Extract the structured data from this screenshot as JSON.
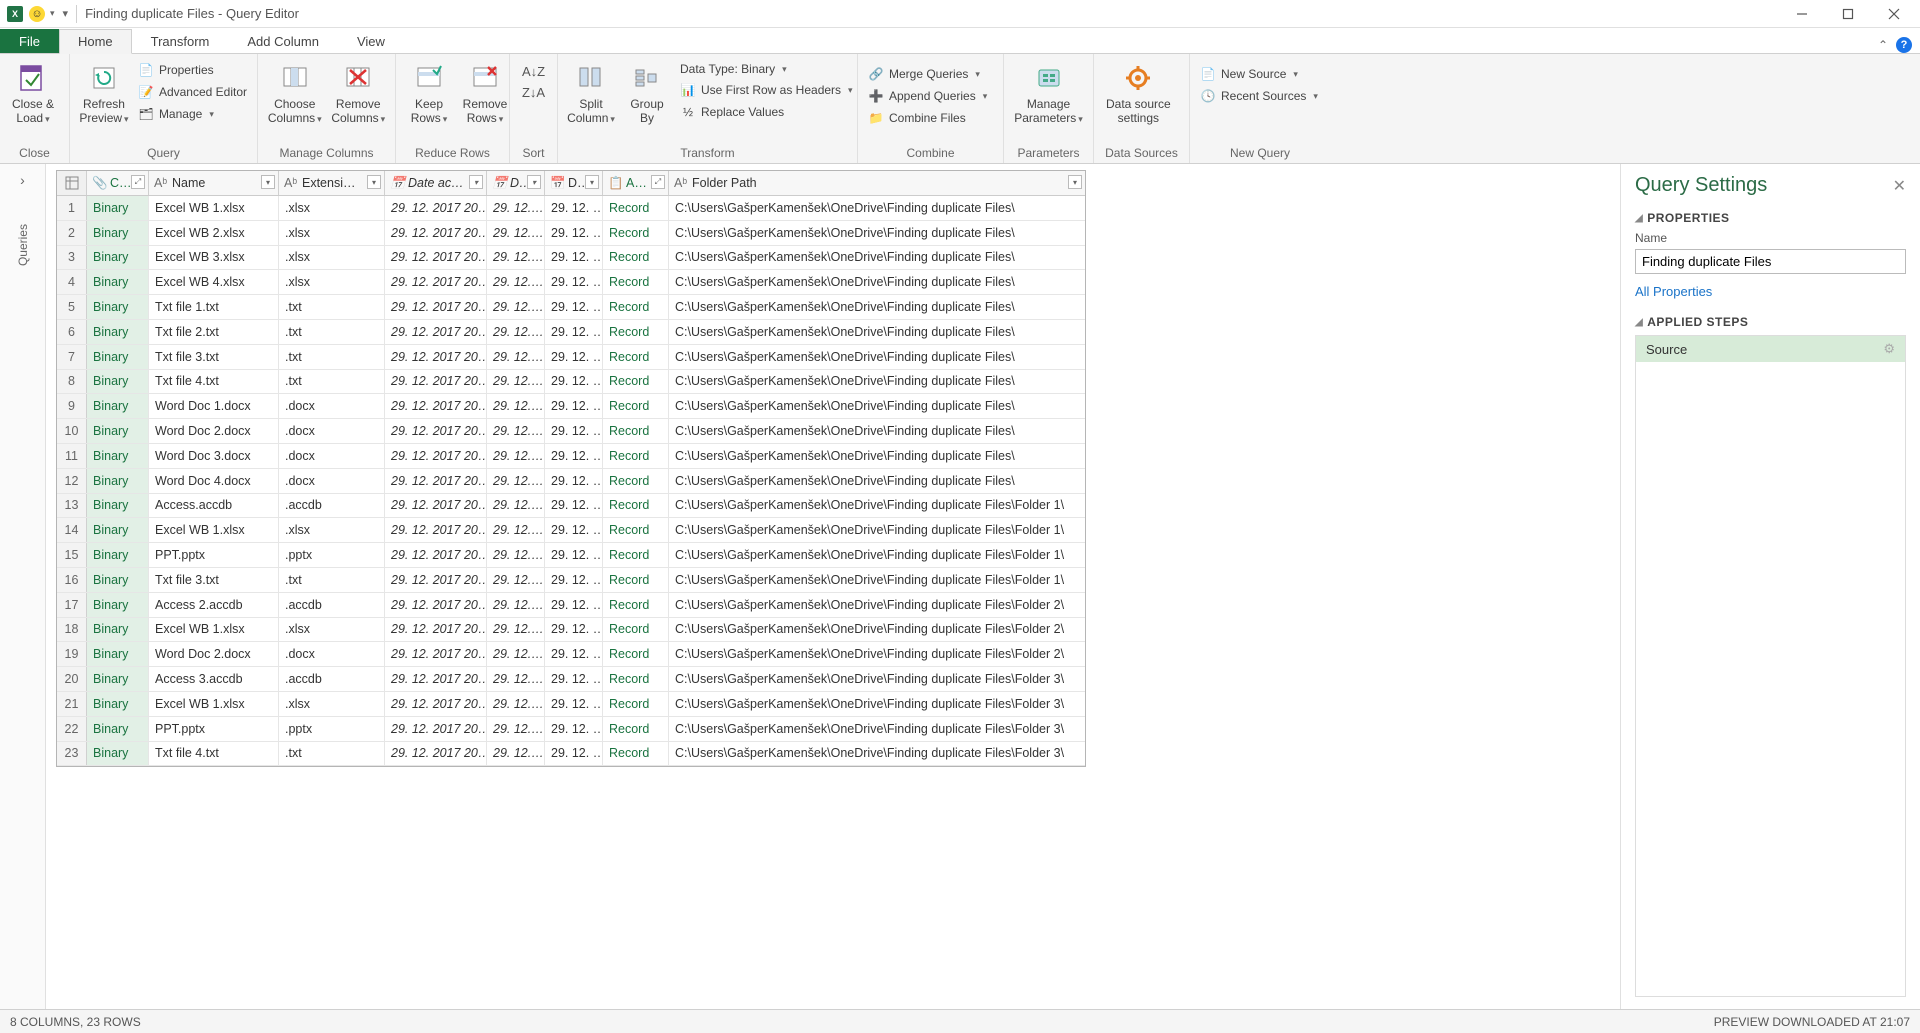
{
  "window": {
    "title": "Finding duplicate Files - Query Editor"
  },
  "tabs": {
    "file": "File",
    "items": [
      "Home",
      "Transform",
      "Add Column",
      "View"
    ],
    "active": "Home"
  },
  "ribbon": {
    "close": {
      "big": "Close &\nLoad",
      "group": "Close"
    },
    "query": {
      "refresh": "Refresh\nPreview",
      "properties": "Properties",
      "advanced": "Advanced Editor",
      "manage": "Manage",
      "group": "Query"
    },
    "manage_columns": {
      "choose": "Choose\nColumns",
      "remove": "Remove\nColumns",
      "group": "Manage Columns"
    },
    "reduce_rows": {
      "keep": "Keep\nRows",
      "remove": "Remove\nRows",
      "group": "Reduce Rows"
    },
    "sort": {
      "group": "Sort"
    },
    "transform": {
      "split": "Split\nColumn",
      "groupby": "Group\nBy",
      "datatype": "Data Type: Binary",
      "firstrow": "Use First Row as Headers",
      "replace": "Replace Values",
      "group": "Transform"
    },
    "combine": {
      "merge": "Merge Queries",
      "append": "Append Queries",
      "combine": "Combine Files",
      "group": "Combine"
    },
    "parameters": {
      "big": "Manage\nParameters",
      "group": "Parameters"
    },
    "datasources": {
      "big": "Data source\nsettings",
      "group": "Data Sources"
    },
    "newquery": {
      "new": "New Source",
      "recent": "Recent Sources",
      "group": "New Query"
    }
  },
  "leftrail": {
    "label": "Queries"
  },
  "columns": {
    "content": "C…",
    "name": "Name",
    "extension": "Extensi…",
    "date_acc": "Date ac…",
    "d2": "D…",
    "d3": "D…",
    "attr": "A…",
    "path": "Folder Path"
  },
  "rows": [
    {
      "n": 1,
      "content": "Binary",
      "name": "Excel WB 1.xlsx",
      "ext": ".xlsx",
      "dacc": "29. 12. 2017 20…",
      "d2": "29. 12.…",
      "d3": "29. 12. …",
      "attr": "Record",
      "path": "C:\\Users\\GašperKamenšek\\OneDrive\\Finding duplicate Files\\"
    },
    {
      "n": 2,
      "content": "Binary",
      "name": "Excel WB 2.xlsx",
      "ext": ".xlsx",
      "dacc": "29. 12. 2017 20…",
      "d2": "29. 12.…",
      "d3": "29. 12. …",
      "attr": "Record",
      "path": "C:\\Users\\GašperKamenšek\\OneDrive\\Finding duplicate Files\\"
    },
    {
      "n": 3,
      "content": "Binary",
      "name": "Excel WB 3.xlsx",
      "ext": ".xlsx",
      "dacc": "29. 12. 2017 20…",
      "d2": "29. 12.…",
      "d3": "29. 12. …",
      "attr": "Record",
      "path": "C:\\Users\\GašperKamenšek\\OneDrive\\Finding duplicate Files\\"
    },
    {
      "n": 4,
      "content": "Binary",
      "name": "Excel WB 4.xlsx",
      "ext": ".xlsx",
      "dacc": "29. 12. 2017 20…",
      "d2": "29. 12.…",
      "d3": "29. 12. …",
      "attr": "Record",
      "path": "C:\\Users\\GašperKamenšek\\OneDrive\\Finding duplicate Files\\"
    },
    {
      "n": 5,
      "content": "Binary",
      "name": "Txt file 1.txt",
      "ext": ".txt",
      "dacc": "29. 12. 2017 20…",
      "d2": "29. 12.…",
      "d3": "29. 12. …",
      "attr": "Record",
      "path": "C:\\Users\\GašperKamenšek\\OneDrive\\Finding duplicate Files\\"
    },
    {
      "n": 6,
      "content": "Binary",
      "name": "Txt file 2.txt",
      "ext": ".txt",
      "dacc": "29. 12. 2017 20…",
      "d2": "29. 12.…",
      "d3": "29. 12. …",
      "attr": "Record",
      "path": "C:\\Users\\GašperKamenšek\\OneDrive\\Finding duplicate Files\\"
    },
    {
      "n": 7,
      "content": "Binary",
      "name": "Txt file 3.txt",
      "ext": ".txt",
      "dacc": "29. 12. 2017 20…",
      "d2": "29. 12.…",
      "d3": "29. 12. …",
      "attr": "Record",
      "path": "C:\\Users\\GašperKamenšek\\OneDrive\\Finding duplicate Files\\"
    },
    {
      "n": 8,
      "content": "Binary",
      "name": "Txt file 4.txt",
      "ext": ".txt",
      "dacc": "29. 12. 2017 20…",
      "d2": "29. 12.…",
      "d3": "29. 12. …",
      "attr": "Record",
      "path": "C:\\Users\\GašperKamenšek\\OneDrive\\Finding duplicate Files\\"
    },
    {
      "n": 9,
      "content": "Binary",
      "name": "Word Doc 1.docx",
      "ext": ".docx",
      "dacc": "29. 12. 2017 20…",
      "d2": "29. 12.…",
      "d3": "29. 12. …",
      "attr": "Record",
      "path": "C:\\Users\\GašperKamenšek\\OneDrive\\Finding duplicate Files\\"
    },
    {
      "n": 10,
      "content": "Binary",
      "name": "Word Doc 2.docx",
      "ext": ".docx",
      "dacc": "29. 12. 2017 20…",
      "d2": "29. 12.…",
      "d3": "29. 12. …",
      "attr": "Record",
      "path": "C:\\Users\\GašperKamenšek\\OneDrive\\Finding duplicate Files\\"
    },
    {
      "n": 11,
      "content": "Binary",
      "name": "Word Doc 3.docx",
      "ext": ".docx",
      "dacc": "29. 12. 2017 20…",
      "d2": "29. 12.…",
      "d3": "29. 12. …",
      "attr": "Record",
      "path": "C:\\Users\\GašperKamenšek\\OneDrive\\Finding duplicate Files\\"
    },
    {
      "n": 12,
      "content": "Binary",
      "name": "Word Doc 4.docx",
      "ext": ".docx",
      "dacc": "29. 12. 2017 20…",
      "d2": "29. 12.…",
      "d3": "29. 12. …",
      "attr": "Record",
      "path": "C:\\Users\\GašperKamenšek\\OneDrive\\Finding duplicate Files\\"
    },
    {
      "n": 13,
      "content": "Binary",
      "name": "Access.accdb",
      "ext": ".accdb",
      "dacc": "29. 12. 2017 20…",
      "d2": "29. 12.…",
      "d3": "29. 12. …",
      "attr": "Record",
      "path": "C:\\Users\\GašperKamenšek\\OneDrive\\Finding duplicate Files\\Folder 1\\"
    },
    {
      "n": 14,
      "content": "Binary",
      "name": "Excel WB 1.xlsx",
      "ext": ".xlsx",
      "dacc": "29. 12. 2017 20…",
      "d2": "29. 12.…",
      "d3": "29. 12. …",
      "attr": "Record",
      "path": "C:\\Users\\GašperKamenšek\\OneDrive\\Finding duplicate Files\\Folder 1\\"
    },
    {
      "n": 15,
      "content": "Binary",
      "name": "PPT.pptx",
      "ext": ".pptx",
      "dacc": "29. 12. 2017 20…",
      "d2": "29. 12.…",
      "d3": "29. 12. …",
      "attr": "Record",
      "path": "C:\\Users\\GašperKamenšek\\OneDrive\\Finding duplicate Files\\Folder 1\\"
    },
    {
      "n": 16,
      "content": "Binary",
      "name": "Txt file 3.txt",
      "ext": ".txt",
      "dacc": "29. 12. 2017 20…",
      "d2": "29. 12.…",
      "d3": "29. 12. …",
      "attr": "Record",
      "path": "C:\\Users\\GašperKamenšek\\OneDrive\\Finding duplicate Files\\Folder 1\\"
    },
    {
      "n": 17,
      "content": "Binary",
      "name": "Access 2.accdb",
      "ext": ".accdb",
      "dacc": "29. 12. 2017 20…",
      "d2": "29. 12.…",
      "d3": "29. 12. …",
      "attr": "Record",
      "path": "C:\\Users\\GašperKamenšek\\OneDrive\\Finding duplicate Files\\Folder 2\\"
    },
    {
      "n": 18,
      "content": "Binary",
      "name": "Excel WB 1.xlsx",
      "ext": ".xlsx",
      "dacc": "29. 12. 2017 20…",
      "d2": "29. 12.…",
      "d3": "29. 12. …",
      "attr": "Record",
      "path": "C:\\Users\\GašperKamenšek\\OneDrive\\Finding duplicate Files\\Folder 2\\"
    },
    {
      "n": 19,
      "content": "Binary",
      "name": "Word Doc 2.docx",
      "ext": ".docx",
      "dacc": "29. 12. 2017 20…",
      "d2": "29. 12.…",
      "d3": "29. 12. …",
      "attr": "Record",
      "path": "C:\\Users\\GašperKamenšek\\OneDrive\\Finding duplicate Files\\Folder 2\\"
    },
    {
      "n": 20,
      "content": "Binary",
      "name": "Access 3.accdb",
      "ext": ".accdb",
      "dacc": "29. 12. 2017 20…",
      "d2": "29. 12.…",
      "d3": "29. 12. …",
      "attr": "Record",
      "path": "C:\\Users\\GašperKamenšek\\OneDrive\\Finding duplicate Files\\Folder 3\\"
    },
    {
      "n": 21,
      "content": "Binary",
      "name": "Excel WB 1.xlsx",
      "ext": ".xlsx",
      "dacc": "29. 12. 2017 20…",
      "d2": "29. 12.…",
      "d3": "29. 12. …",
      "attr": "Record",
      "path": "C:\\Users\\GašperKamenšek\\OneDrive\\Finding duplicate Files\\Folder 3\\"
    },
    {
      "n": 22,
      "content": "Binary",
      "name": "PPT.pptx",
      "ext": ".pptx",
      "dacc": "29. 12. 2017 20…",
      "d2": "29. 12.…",
      "d3": "29. 12. …",
      "attr": "Record",
      "path": "C:\\Users\\GašperKamenšek\\OneDrive\\Finding duplicate Files\\Folder 3\\"
    },
    {
      "n": 23,
      "content": "Binary",
      "name": "Txt file 4.txt",
      "ext": ".txt",
      "dacc": "29. 12. 2017 20…",
      "d2": "29. 12.…",
      "d3": "29. 12. …",
      "attr": "Record",
      "path": "C:\\Users\\GašperKamenšek\\OneDrive\\Finding duplicate Files\\Folder 3\\"
    }
  ],
  "rpanel": {
    "title": "Query Settings",
    "properties": "PROPERTIES",
    "name_label": "Name",
    "name_value": "Finding duplicate Files",
    "all_props": "All Properties",
    "applied_steps": "APPLIED STEPS",
    "step_source": "Source"
  },
  "status": {
    "left": "8 COLUMNS, 23 ROWS",
    "right": "PREVIEW DOWNLOADED AT 21:07"
  }
}
